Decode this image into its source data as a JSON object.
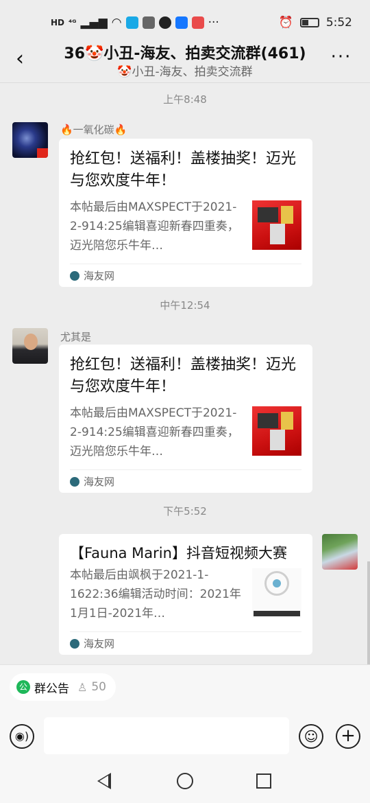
{
  "status_bar": {
    "left_labels": [
      "HD",
      "⁴ᴳ"
    ],
    "more": "···",
    "time": "5:52"
  },
  "header": {
    "title": "36🤡小丑-海友、拍卖交流群(461)",
    "subtitle": "🤡小丑-海友、拍卖交流群",
    "back_icon": "‹",
    "more_icon": "···"
  },
  "messages": [
    {
      "time": "上午8:48",
      "sender": "🔥一氧化碳🔥",
      "side": "left",
      "card": {
        "title": "抢红包！送福利！盖楼抽奖！迈光与您欢度牛年！",
        "desc": "本帖最后由MAXSPECT于2021-2-914:25编辑喜迎新春四重奏，迈光陪您乐牛年…",
        "source": "海友网"
      }
    },
    {
      "time": "中午12:54",
      "sender": "尤其是",
      "side": "left",
      "card": {
        "title": "抢红包！送福利！盖楼抽奖！迈光与您欢度牛年！",
        "desc": "本帖最后由MAXSPECT于2021-2-914:25编辑喜迎新春四重奏，迈光陪您乐牛年…",
        "source": "海友网"
      }
    },
    {
      "time": "下午5:52",
      "sender": "",
      "side": "right",
      "card": {
        "title": "【Fauna Marin】抖音短视频大赛",
        "desc": "本帖最后由飒枫于2021-1-1622:36编辑活动时间：2021年1月1日-2021年…",
        "source": "海友网"
      }
    }
  ],
  "bottom": {
    "notice_label": "群公告",
    "notice_icon": "公",
    "member_count": "50",
    "person_icon": "♙",
    "voice_icon": "◉)",
    "emoji_icon": "☺",
    "plus_icon": "+"
  },
  "colors": {
    "background": "#ededed",
    "card": "#ffffff",
    "notice_green": "#1fb85a"
  }
}
